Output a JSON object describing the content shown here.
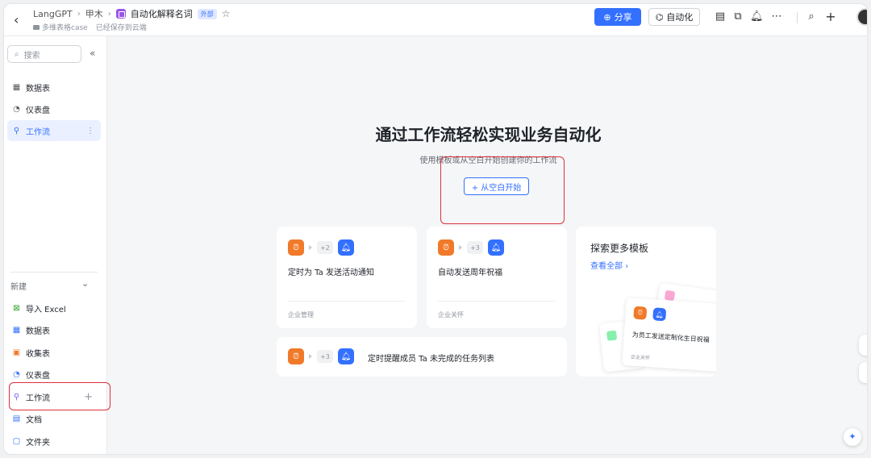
{
  "header": {
    "breadcrumbs": [
      "LangGPT",
      "甲木",
      "自动化解释名词"
    ],
    "badge": "外部",
    "sub_folder": "多维表格case",
    "save_status": "已经保存到云端",
    "share_label": "分享",
    "automation_label": "自动化"
  },
  "sidebar": {
    "search_placeholder": "搜索",
    "items": [
      {
        "label": "数据表",
        "icon": "table-icon"
      },
      {
        "label": "仪表盘",
        "icon": "dashboard-icon"
      },
      {
        "label": "工作流",
        "icon": "workflow-icon",
        "active": true
      }
    ],
    "new_section_label": "新建",
    "new_items": [
      {
        "label": "导入 Excel",
        "icon": "excel-icon"
      },
      {
        "label": "数据表",
        "icon": "table-icon"
      },
      {
        "label": "收集表",
        "icon": "form-icon"
      },
      {
        "label": "仪表盘",
        "icon": "dashboard-icon"
      },
      {
        "label": "工作流",
        "icon": "workflow-icon"
      },
      {
        "label": "文档",
        "icon": "doc-icon"
      },
      {
        "label": "文件夹",
        "icon": "folder-icon"
      }
    ]
  },
  "main": {
    "title": "通过工作流轻松实现业务自动化",
    "subtitle": "使用模板或从空白开始创建你的工作流",
    "start_button": "+ 从空白开始",
    "templates": [
      {
        "count": "+2",
        "title": "定时为 Ta 发送活动通知",
        "category": "企业管理"
      },
      {
        "count": "+3",
        "title": "自动发送周年祝福",
        "category": "企业关怀"
      },
      {
        "count": "+3",
        "title": "定时提醒成员 Ta 未完成的任务列表"
      }
    ],
    "explore": {
      "title": "探索更多模板",
      "link": "查看全部",
      "preview_title": "为员工发送定制化生日祝福",
      "preview_category": "企业关怀"
    }
  },
  "colors": {
    "accent": "#3370ff",
    "highlight": "#e0303a",
    "tile_orange": "#f07a2a"
  }
}
